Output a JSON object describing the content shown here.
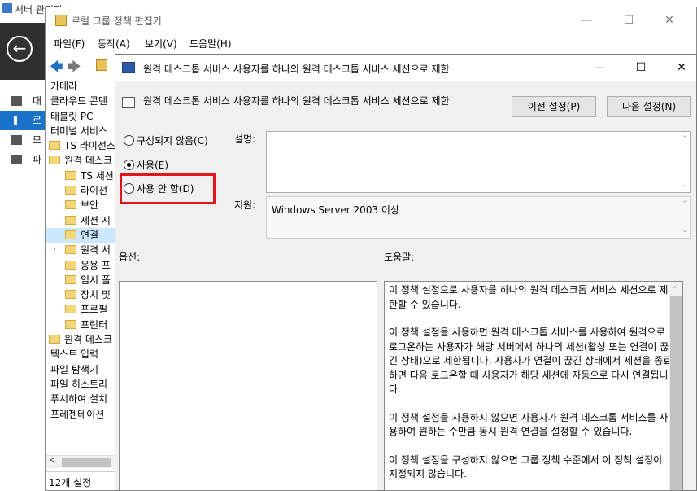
{
  "server_manager": {
    "title": "서버 관리자",
    "nav": [
      {
        "label": "대"
      },
      {
        "label": "로"
      },
      {
        "label": "모"
      },
      {
        "label": "파"
      }
    ]
  },
  "gpe": {
    "title": "로컬 그룹 정책 편집기",
    "menu": [
      "파일(F)",
      "동작(A)",
      "보기(V)",
      "도움말(H)"
    ],
    "tree": [
      {
        "label": "카메라",
        "indent": 0,
        "folder": false
      },
      {
        "label": "클라우드 콘텐",
        "indent": 0,
        "folder": false
      },
      {
        "label": "태블릿 PC",
        "indent": 0,
        "folder": false
      },
      {
        "label": "터미널 서비스",
        "indent": 0,
        "folder": false
      },
      {
        "label": "TS 라이선스",
        "indent": 0,
        "folder": true
      },
      {
        "label": "원격 데스크",
        "indent": 0,
        "folder": true
      },
      {
        "label": "TS 세션",
        "indent": 1,
        "folder": true
      },
      {
        "label": "라이선",
        "indent": 1,
        "folder": true
      },
      {
        "label": "보안",
        "indent": 1,
        "folder": true
      },
      {
        "label": "세션 시",
        "indent": 1,
        "folder": true
      },
      {
        "label": "연결",
        "indent": 1,
        "folder": true,
        "selected": true
      },
      {
        "label": "원격 서",
        "indent": 1,
        "folder": true,
        "expand": true
      },
      {
        "label": "응용 프",
        "indent": 1,
        "folder": true
      },
      {
        "label": "임시 폴",
        "indent": 1,
        "folder": true
      },
      {
        "label": "장치 및",
        "indent": 1,
        "folder": true
      },
      {
        "label": "프로필",
        "indent": 1,
        "folder": true
      },
      {
        "label": "프린터",
        "indent": 1,
        "folder": true
      },
      {
        "label": "원격 데스크",
        "indent": 0,
        "folder": true
      },
      {
        "label": "텍스트 입력",
        "indent": 0,
        "folder": false
      },
      {
        "label": "파일 탐색기",
        "indent": 0,
        "folder": false
      },
      {
        "label": "파일 히스토리",
        "indent": 0,
        "folder": false
      },
      {
        "label": "푸시하여 설치",
        "indent": 0,
        "folder": false
      },
      {
        "label": "프레젠테이션",
        "indent": 0,
        "folder": false
      }
    ],
    "status": "12개 설정"
  },
  "dialog": {
    "title": "원격 데스크톱 서비스 사용자를 하나의 원격 데스크톱 서비스 세션으로 제한",
    "header_text": "원격 데스크톱 서비스 사용자를 하나의 원격 데스크톱 서비스 세션으로 제한",
    "prev_button": "이전 설정(P)",
    "next_button": "다음 설정(N)",
    "radio_not_configured": "구성되지 않음(C)",
    "radio_enabled": "사용(E)",
    "radio_disabled": "사용 안 함(D)",
    "comment_label": "설명:",
    "supported_label": "지원:",
    "supported_value": "Windows Server 2003 이상",
    "options_label": "옵션:",
    "help_label": "도움말:",
    "help_paragraphs": [
      "이 정책 설정으로 사용자를 하나의 원격 데스크톱 서비스 세션으로 제한할 수 있습니다.",
      "이 정책 설정을 사용하면 원격 데스크톱 서비스를 사용하여 원격으로 로그온하는 사용자가 해당 서버에서 하나의 세션(활성 또는 연결이 끊긴 상태)으로 제한됩니다. 사용자가 연결이 끊긴 상태에서 세션을 종료하면 다음 로그온할 때 사용자가 해당 세션에 자동으로 다시 연결됩니다.",
      "이 정책 설정을 사용하지 않으면 사용자가 원격 데스크톱 서비스를 사용하여 원하는 수만큼 동시 원격 연결을 설정할 수 있습니다.",
      "이 정책 설정을 구성하지 않으면 그룹 정책 수준에서 이 정책 설정이 지정되지 않습니다."
    ]
  }
}
